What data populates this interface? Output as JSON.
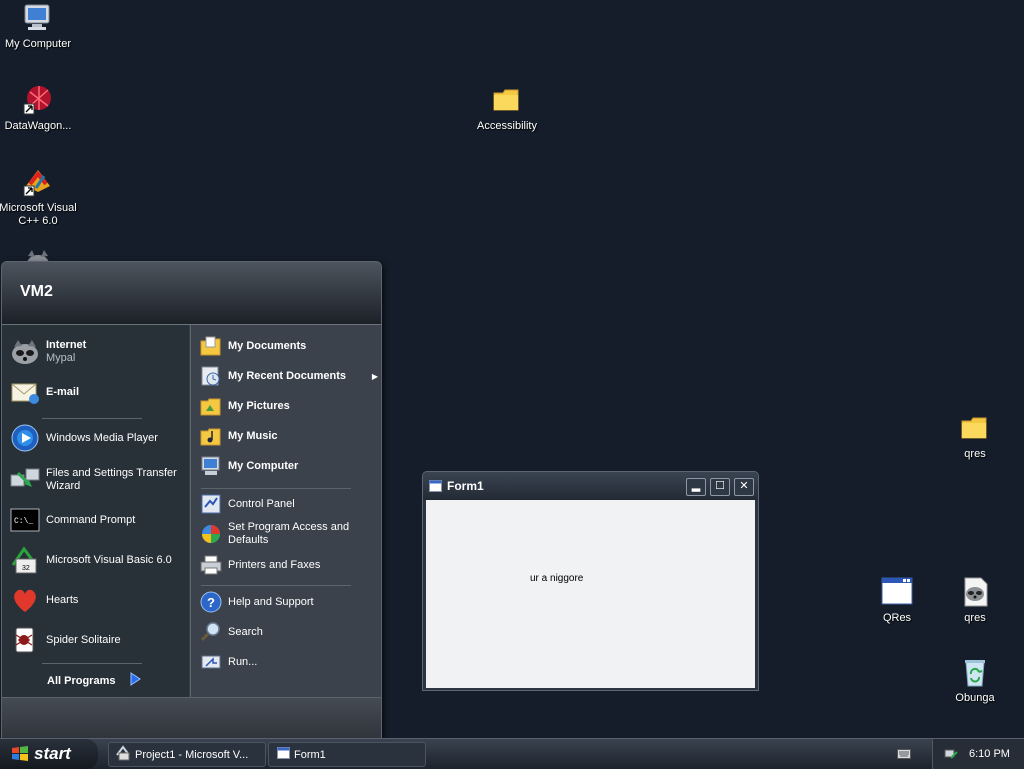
{
  "desktop": {
    "icons": [
      {
        "label": "My Computer"
      },
      {
        "label": "DataWagon..."
      },
      {
        "label": "Microsoft Visual C++ 6.0"
      },
      {
        "label": "Accessibility"
      },
      {
        "label": "qres"
      },
      {
        "label": "QRes"
      },
      {
        "label": "qres"
      },
      {
        "label": "Obunga"
      }
    ]
  },
  "start_menu": {
    "user": "VM2",
    "pinned": [
      {
        "title": "Internet",
        "subtitle": "Mypal"
      },
      {
        "title": "E-mail"
      }
    ],
    "recent": [
      {
        "label": "Windows Media Player"
      },
      {
        "label": "Files and Settings Transfer Wizard"
      },
      {
        "label": "Command Prompt"
      },
      {
        "label": "Microsoft Visual Basic 6.0"
      },
      {
        "label": "Hearts"
      },
      {
        "label": "Spider Solitaire"
      }
    ],
    "all_programs": "All Programs",
    "places": [
      {
        "label": "My Documents"
      },
      {
        "label": "My Recent Documents"
      },
      {
        "label": "My Pictures"
      },
      {
        "label": "My Music"
      },
      {
        "label": "My Computer"
      }
    ],
    "settings": [
      {
        "label": "Control Panel"
      },
      {
        "label": "Set Program Access and Defaults"
      },
      {
        "label": "Printers and Faxes"
      }
    ],
    "help": [
      {
        "label": "Help and Support"
      },
      {
        "label": "Search"
      },
      {
        "label": "Run..."
      }
    ]
  },
  "form1": {
    "title": "Form1",
    "label_text": "ur a niggore"
  },
  "taskbar": {
    "start_label": "start",
    "tasks": [
      {
        "label": "Project1 - Microsoft V..."
      },
      {
        "label": "Form1"
      }
    ],
    "clock": "6:10 PM"
  }
}
